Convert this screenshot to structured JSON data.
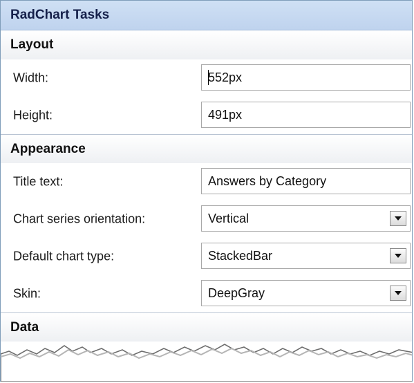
{
  "title": "RadChart Tasks",
  "layout": {
    "heading": "Layout",
    "width_label": "Width:",
    "width_value": "552px",
    "height_label": "Height:",
    "height_value": "491px"
  },
  "appearance": {
    "heading": "Appearance",
    "title_text_label": "Title text:",
    "title_text_value": "Answers by Category",
    "orientation_label": "Chart series orientation:",
    "orientation_value": "Vertical",
    "chart_type_label": "Default chart type:",
    "chart_type_value": "StackedBar",
    "skin_label": "Skin:",
    "skin_value": "DeepGray"
  },
  "data": {
    "heading": "Data"
  },
  "icons": {
    "dropdown": "chevron-down-icon"
  }
}
